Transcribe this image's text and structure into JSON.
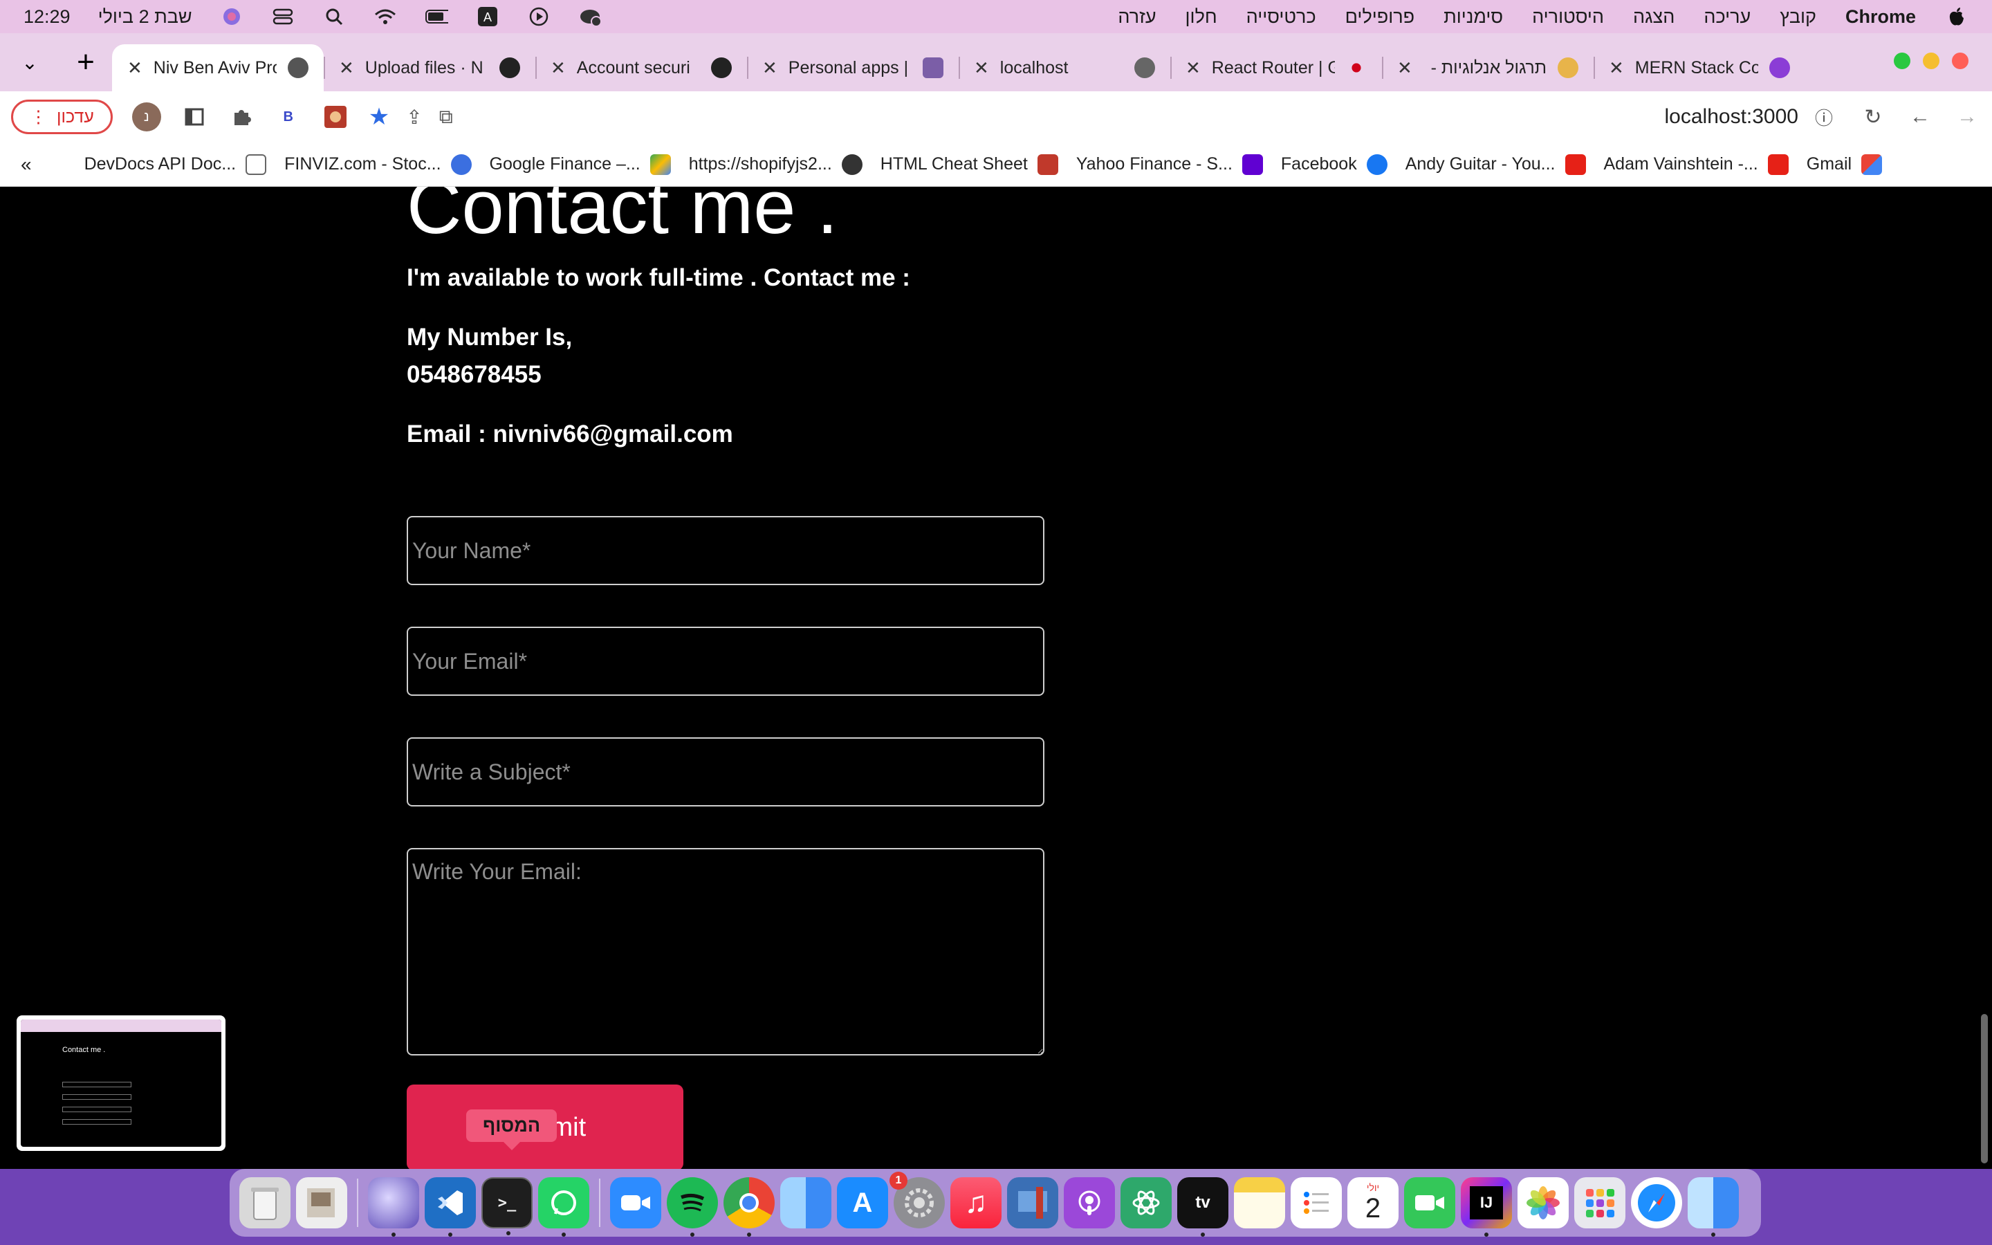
{
  "menubar": {
    "clock": "12:29",
    "date": "שבת 2 ביולי",
    "menus": [
      "עזרה",
      "חלון",
      "כרטיסייה",
      "פרופילים",
      "סימניות",
      "היסטוריה",
      "הצגה",
      "עריכה",
      "קובץ"
    ],
    "app_name": "Chrome"
  },
  "tabs": [
    {
      "title": "Niv Ben Aviv Pro",
      "active": true
    },
    {
      "title": "Upload files · N"
    },
    {
      "title": "Account securi"
    },
    {
      "title": "Personal apps |"
    },
    {
      "title": "localhost"
    },
    {
      "title": "React Router | G"
    },
    {
      "title": "תרגול אנלוגיות -"
    },
    {
      "title": "MERN Stack Co"
    }
  ],
  "toolbar": {
    "update_label": "עדכון",
    "avatar_letter": "נ",
    "ext_letter": "B",
    "url": "localhost:3000"
  },
  "bookmarks": [
    "DevDocs API Doc...",
    "FINVIZ.com - Stoc...",
    "Google Finance –...",
    "https://shopifyjs2...",
    "HTML Cheat Sheet",
    "Yahoo Finance - S...",
    "Facebook",
    "Andy Guitar - You...",
    "Adam Vainshtein -...",
    "Gmail"
  ],
  "page": {
    "heading": "Contact me .",
    "availability": "I'm available to work full-time . Contact me :",
    "number_label": "My Number Is,",
    "number": "0548678455",
    "email_line": "Email : nivniv66@gmail.com",
    "form": {
      "name_placeholder": "Your Name*",
      "email_placeholder": "Your Email*",
      "subject_placeholder": "Write a Subject*",
      "message_placeholder": "Write Your Email:",
      "submit_label": "Submit"
    },
    "tooltip": "המסוף"
  },
  "thumbnail": {
    "heading": "Contact me ."
  },
  "dock": {
    "mail_badge": "1",
    "calendar_month": "יולי",
    "calendar_day": "2"
  },
  "colors": {
    "menubar_bg": "#e9c3e6",
    "tabstrip_bg": "#ead1ea",
    "page_bg": "#000000",
    "submit_bg": "#e0244f",
    "dock_bg": "#6f43b5"
  }
}
